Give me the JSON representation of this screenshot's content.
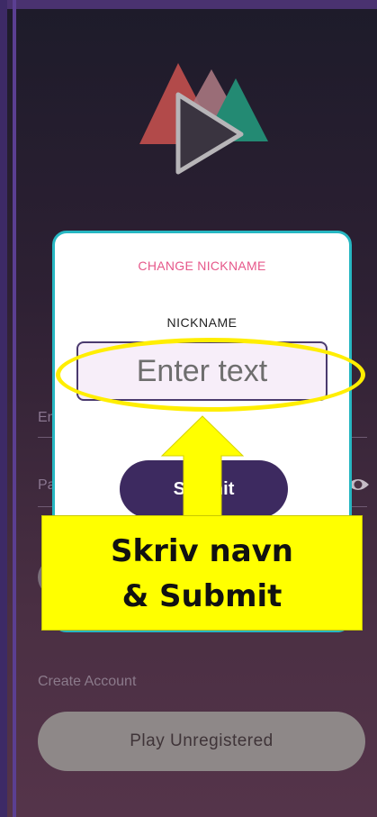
{
  "background_form": {
    "email_label": "Email",
    "password_label": "Password",
    "create_account": "Create Account",
    "play_unregistered": "Play Unregistered"
  },
  "modal": {
    "title": "CHANGE NICKNAME",
    "field_label": "NICKNAME",
    "input_placeholder": "Enter text",
    "input_value": "",
    "submit_label": "Submit"
  },
  "annotation": {
    "callout_text": "Skriv navn\n& Submit",
    "color": "#ffff00"
  },
  "icons": [
    "app-logo-icon",
    "eye-icon",
    "arrow-up-icon"
  ],
  "colors": {
    "modal_border": "#27b7c2",
    "title": "#e6578a",
    "submit": "#3d2a60",
    "highlight": "#ffee00"
  }
}
